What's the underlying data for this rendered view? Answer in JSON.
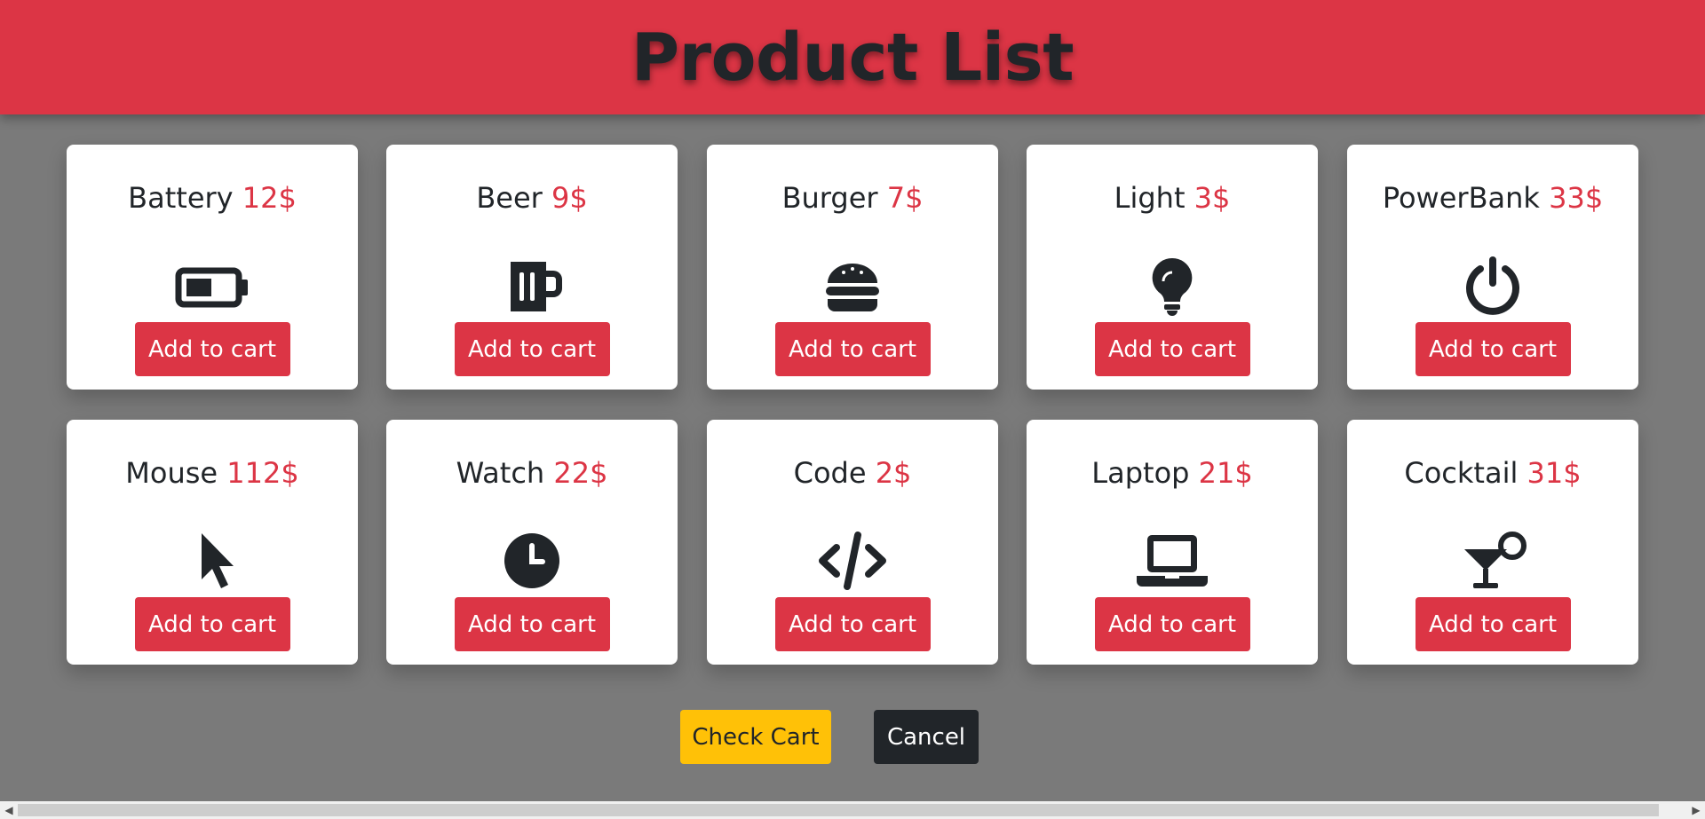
{
  "header": {
    "title": "Product List"
  },
  "products": [
    {
      "name": "Battery",
      "price": "12$",
      "icon": "battery-icon",
      "button": "Add to cart"
    },
    {
      "name": "Beer",
      "price": "9$",
      "icon": "beer-icon",
      "button": "Add to cart"
    },
    {
      "name": "Burger",
      "price": "7$",
      "icon": "burger-icon",
      "button": "Add to cart"
    },
    {
      "name": "Light",
      "price": "3$",
      "icon": "lightbulb-icon",
      "button": "Add to cart"
    },
    {
      "name": "PowerBank",
      "price": "33$",
      "icon": "power-icon",
      "button": "Add to cart"
    },
    {
      "name": "Mouse",
      "price": "112$",
      "icon": "mouse-pointer-icon",
      "button": "Add to cart"
    },
    {
      "name": "Watch",
      "price": "22$",
      "icon": "clock-icon",
      "button": "Add to cart"
    },
    {
      "name": "Code",
      "price": "2$",
      "icon": "code-icon",
      "button": "Add to cart"
    },
    {
      "name": "Laptop",
      "price": "21$",
      "icon": "laptop-icon",
      "button": "Add to cart"
    },
    {
      "name": "Cocktail",
      "price": "31$",
      "icon": "cocktail-icon",
      "button": "Add to cart"
    }
  ],
  "actions": {
    "check_cart": "Check Cart",
    "cancel": "Cancel"
  },
  "colors": {
    "accent": "#dc3545",
    "background": "#7a7a7a",
    "warning": "#ffc107",
    "dark": "#212529"
  }
}
